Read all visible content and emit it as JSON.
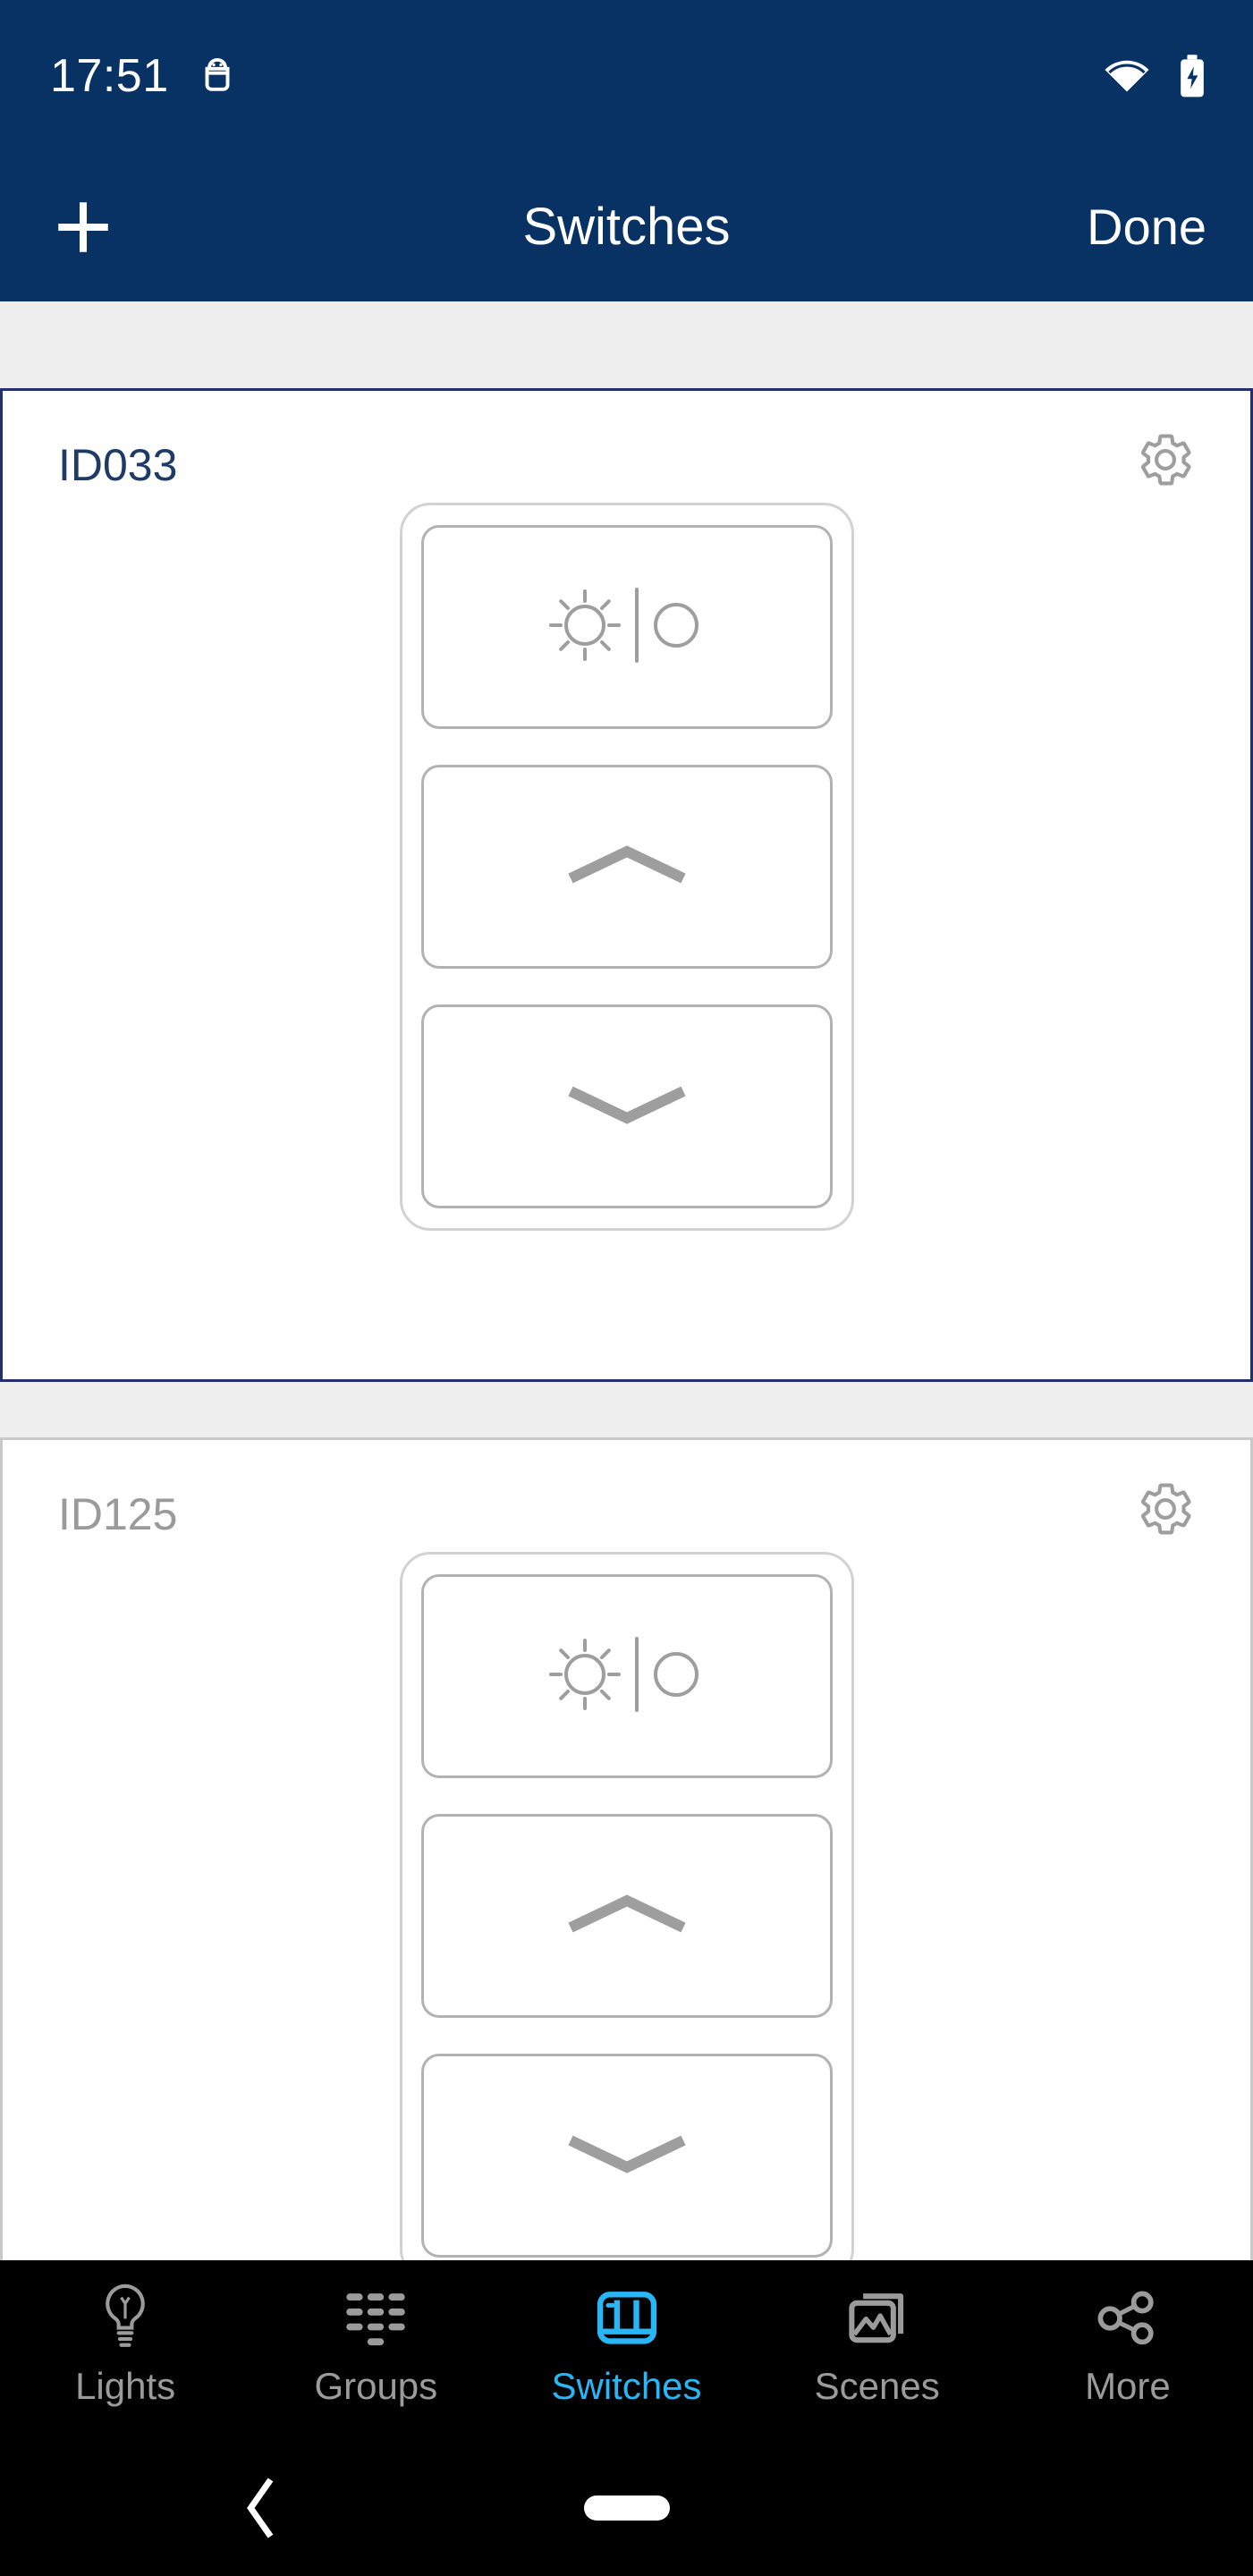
{
  "status_bar": {
    "time": "17:51",
    "icons": [
      "android-debug-icon",
      "wifi-icon",
      "battery-charging-icon"
    ],
    "background": "#073263"
  },
  "app_bar": {
    "add_label": "+",
    "title": "Switches",
    "done_label": "Done",
    "background": "#073263",
    "text_color": "#ffffff"
  },
  "cards": [
    {
      "id_label": "ID033",
      "selected": true,
      "border_color": "#24306b",
      "title_color": "#1d3b66",
      "gear_icon": "gear-icon",
      "rockers": [
        {
          "icon": "brightness-power-icon"
        },
        {
          "icon": "chevron-up-icon"
        },
        {
          "icon": "chevron-down-icon"
        }
      ]
    },
    {
      "id_label": "ID125",
      "selected": false,
      "border_color": "#c9c9c9",
      "title_color": "#9a9a9a",
      "gear_icon": "gear-icon",
      "rockers": [
        {
          "icon": "brightness-power-icon"
        },
        {
          "icon": "chevron-up-icon"
        },
        {
          "icon": "chevron-down-icon"
        }
      ]
    }
  ],
  "tab_bar": {
    "background": "#000000",
    "active_color": "#29b6f6",
    "inactive_color": "#9b9b9b",
    "items": [
      {
        "label": "Lights",
        "icon": "lightbulb-icon",
        "active": false
      },
      {
        "label": "Groups",
        "icon": "grid-dots-icon",
        "active": false
      },
      {
        "label": "Switches",
        "icon": "switch-panel-icon",
        "active": true
      },
      {
        "label": "Scenes",
        "icon": "photos-stack-icon",
        "active": false
      },
      {
        "label": "More",
        "icon": "share-nodes-icon",
        "active": false
      }
    ]
  },
  "nav_bar": {
    "back_icon": "chevron-left-icon",
    "home_icon": "home-pill-icon",
    "background": "#000000"
  }
}
